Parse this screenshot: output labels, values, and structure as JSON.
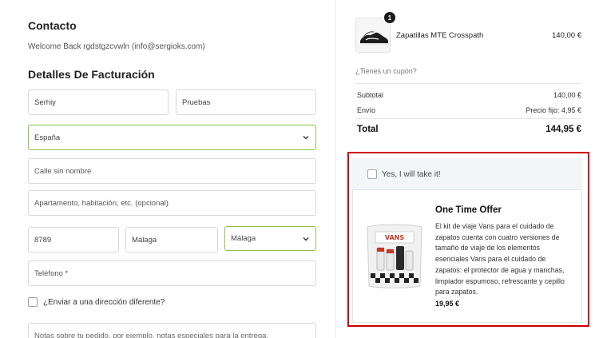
{
  "contact": {
    "heading": "Contacto",
    "welcome": "Welcome Back rgdstgzcvwln (info@sergioks.com)"
  },
  "billing": {
    "heading": "Detalles De Facturación",
    "first_name": "Serhiy",
    "last_name": "Pruebas",
    "country": "España",
    "street_placeholder": "Calle sin nombre",
    "apartment_placeholder": "Apartamento, habitación, etc. (opcional)",
    "postcode": "8789",
    "city": "Málaga",
    "province": "Málaga",
    "phone_placeholder": "Teléfono *",
    "ship_different_label": "¿Enviar a una dirección diferente?",
    "notes_placeholder": "Notas sobre tu pedido, por ejemplo, notas especiales para la entrega."
  },
  "summary": {
    "product": {
      "name": "Zapatillas MTE Crosspath",
      "price": "140,00 €",
      "quantity": "1",
      "icon": "shoe-thumbnail"
    },
    "coupon_link": "¿Tienes un cupón?",
    "subtotal_label": "Subtotal",
    "subtotal_value": "140,00 €",
    "shipping_label": "Envío",
    "shipping_value": "Precio fijo: 4,95 €",
    "total_label": "Total",
    "total_value": "144,95 €"
  },
  "offer": {
    "accept_label": "Yes, I will take it!",
    "title": "One Time Offer",
    "description": "El kit de viaje Vans para el cuidado de zapatos cuenta con cuatro versiones de tamaño de viaje de los elementos esenciales Vans para el cuidado de zapatos: el protector de agua y manchas, limpiador espumoso, refrescante y cepillo para zapatos.",
    "price": "19,95 €",
    "highlight_color": "#cc0000"
  }
}
